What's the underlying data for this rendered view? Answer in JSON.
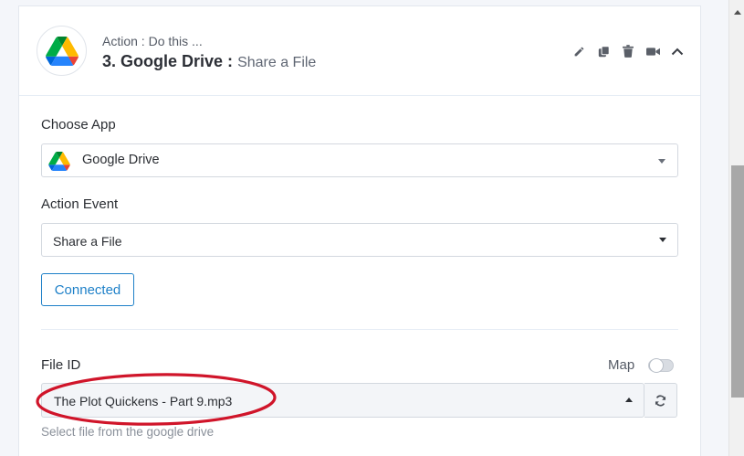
{
  "step": {
    "subtitle": "Action : Do this ...",
    "title": "3. Google Drive :",
    "event": "Share a File"
  },
  "choose_app": {
    "label": "Choose App",
    "value": "Google Drive"
  },
  "action_event": {
    "label": "Action Event",
    "value": "Share a File"
  },
  "connection": {
    "label": "Connected"
  },
  "file_id": {
    "label": "File ID",
    "map_label": "Map",
    "map_enabled": false,
    "value": "The Plot Quickens - Part 9.mp3",
    "help": "Select file from the google drive"
  },
  "header_icons": [
    "pencil-icon",
    "copy-icon",
    "trash-icon",
    "video-icon",
    "chevron-up-icon"
  ],
  "colors": {
    "accent": "#1e80c8",
    "annotation": "#d0152a",
    "drive_green": "#1fa463",
    "drive_yellow": "#ffd04b",
    "drive_blue": "#4688f4"
  }
}
